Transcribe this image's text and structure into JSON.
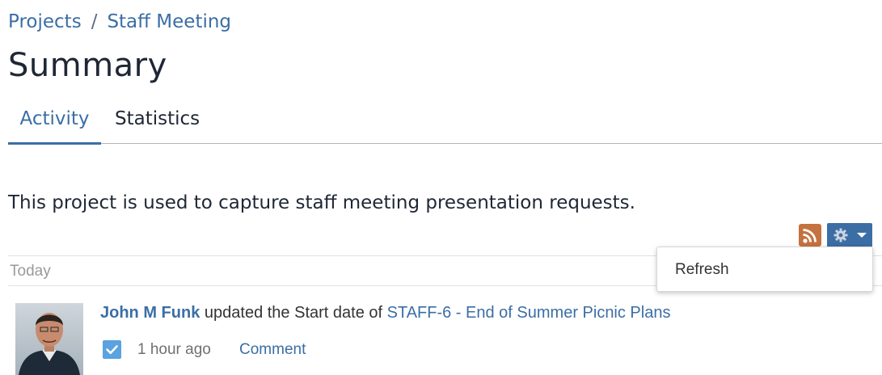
{
  "breadcrumb": {
    "items": [
      "Projects",
      "Staff Meeting"
    ],
    "separator": "/"
  },
  "page": {
    "title": "Summary",
    "description": "This project is used to capture staff meeting presentation requests."
  },
  "tabs": [
    {
      "label": "Activity",
      "active": true
    },
    {
      "label": "Statistics",
      "active": false
    }
  ],
  "toolbar": {
    "rss_icon": "rss-feed-icon",
    "settings_icon": "gear-icon",
    "settings_caret_icon": "caret-down-icon",
    "accent_color": "#3b6ea5",
    "rss_color": "#c4723f"
  },
  "menu": {
    "items": [
      "Refresh"
    ]
  },
  "activity": {
    "date_heading": "Today",
    "entries": [
      {
        "user": "John M Funk",
        "action": "updated the Start date of",
        "issue": "STAFF-6 - End of Summer Picnic Plans",
        "issue_type_icon": "task-checkbox-icon",
        "time": "1 hour ago",
        "comment_label": "Comment"
      }
    ]
  }
}
